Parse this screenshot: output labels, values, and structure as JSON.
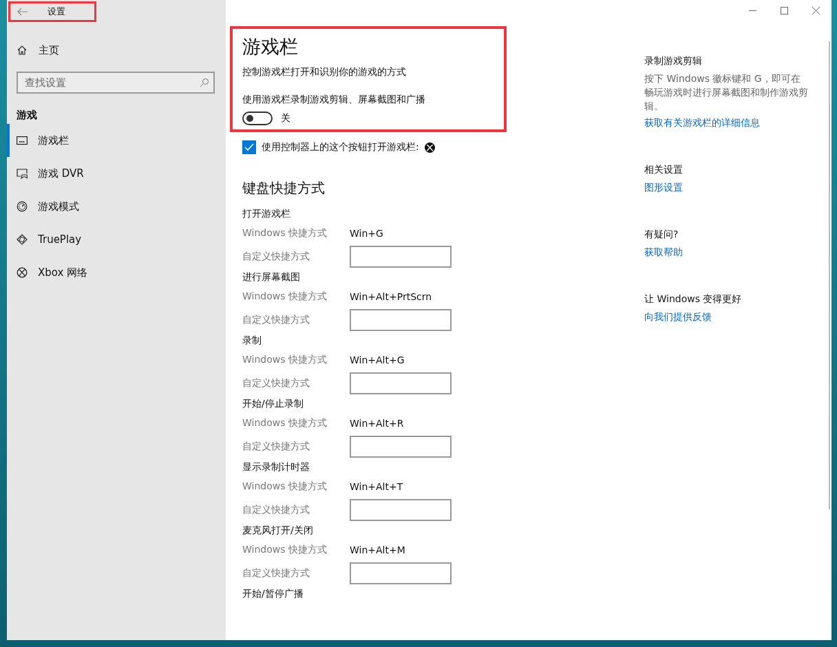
{
  "window": {
    "title": "设置"
  },
  "sidebar": {
    "home": "主页",
    "search": {
      "placeholder": "查找设置"
    },
    "section": "游戏",
    "items": [
      {
        "label": "游戏栏",
        "kind": "gamebar",
        "selected": true
      },
      {
        "label": "游戏 DVR",
        "kind": "dvr",
        "selected": false
      },
      {
        "label": "游戏模式",
        "kind": "mode",
        "selected": false
      },
      {
        "label": "TruePlay",
        "kind": "trueplay",
        "selected": false
      },
      {
        "label": "Xbox 网络",
        "kind": "xbox",
        "selected": false
      }
    ]
  },
  "main": {
    "title": "游戏栏",
    "description": "控制游戏栏打开和识别你的游戏的方式",
    "toggle": {
      "label": "使用游戏栏录制游戏剪辑、屏幕截图和广播",
      "on": false,
      "state_text": "关"
    },
    "checkbox": {
      "label": "使用控制器上的这个按钮打开游戏栏:",
      "checked": true
    },
    "shortcuts_heading": "键盘快捷方式",
    "shortcuts": [
      {
        "title": "打开游戏栏",
        "windows_label": "Windows 快捷方式",
        "windows_value": "Win+G",
        "custom_label": "自定义快捷方式"
      },
      {
        "title": "进行屏幕截图",
        "windows_label": "Windows 快捷方式",
        "windows_value": "Win+Alt+PrtScrn",
        "custom_label": "自定义快捷方式"
      },
      {
        "title": "录制",
        "windows_label": "Windows 快捷方式",
        "windows_value": "Win+Alt+G",
        "custom_label": "自定义快捷方式"
      },
      {
        "title": "开始/停止录制",
        "windows_label": "Windows 快捷方式",
        "windows_value": "Win+Alt+R",
        "custom_label": "自定义快捷方式"
      },
      {
        "title": "显示录制计时器",
        "windows_label": "Windows 快捷方式",
        "windows_value": "Win+Alt+T",
        "custom_label": "自定义快捷方式"
      },
      {
        "title": "麦克风打开/关闭",
        "windows_label": "Windows 快捷方式",
        "windows_value": "Win+Alt+M",
        "custom_label": "自定义快捷方式"
      },
      {
        "title": "开始/暂停广播"
      }
    ]
  },
  "aside": [
    {
      "heading": "录制游戏剪辑",
      "text": "按下 Windows 徽标键和 G，即可在畅玩游戏时进行屏幕截图和制作游戏剪辑。",
      "link": "获取有关游戏栏的详细信息"
    },
    {
      "heading": "相关设置",
      "link": "图形设置"
    },
    {
      "heading": "有疑问?",
      "link": "获取帮助"
    },
    {
      "heading": "让 Windows 变得更好",
      "link": "向我们提供反馈"
    }
  ]
}
